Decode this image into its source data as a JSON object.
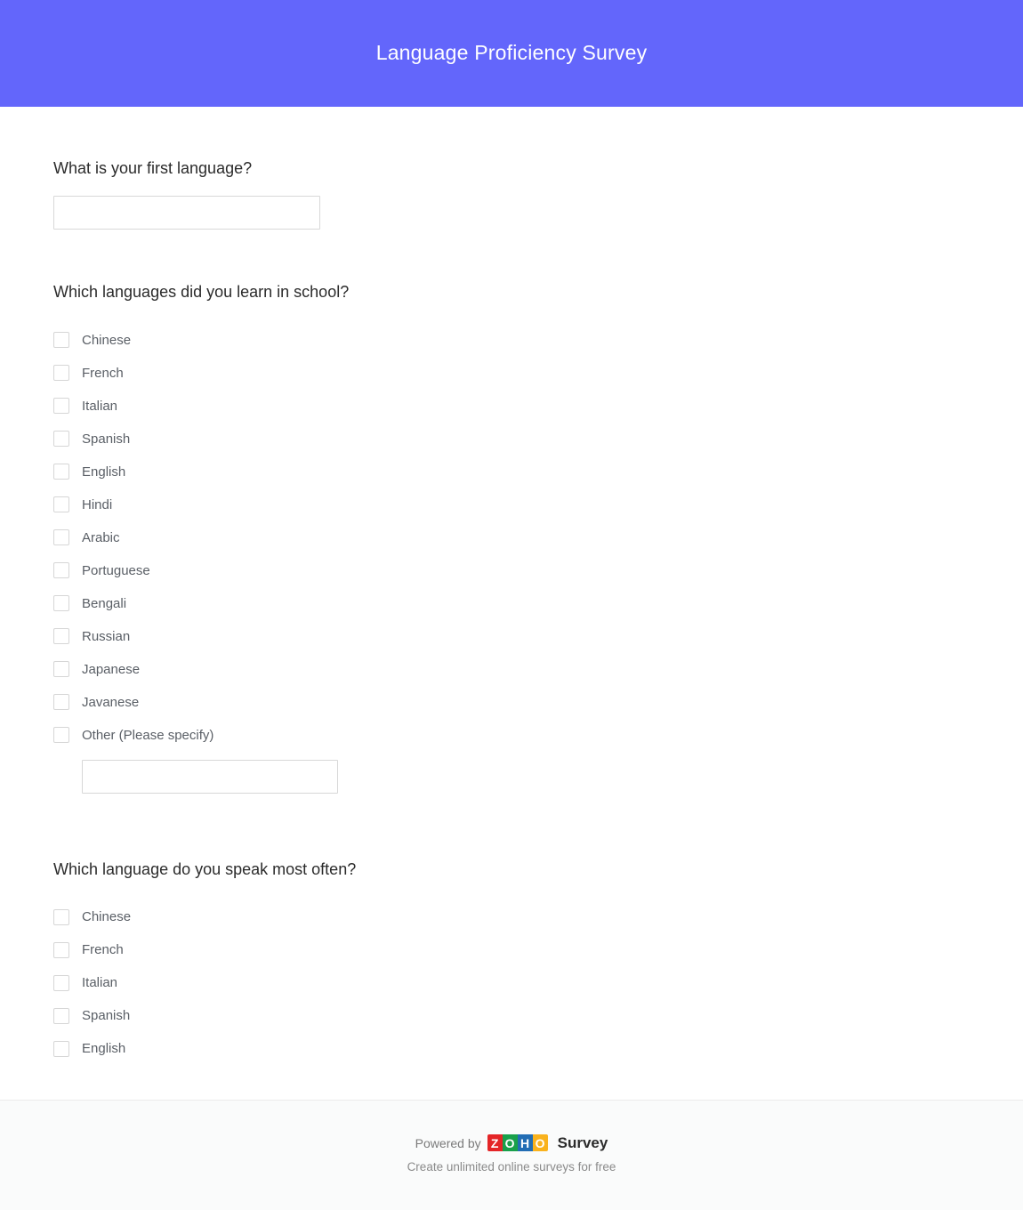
{
  "header": {
    "title": "Language Proficiency Survey",
    "background_color": "#6366fb",
    "text_color": "#ffffff"
  },
  "questions": [
    {
      "id": "q1",
      "title": "What is your first language?",
      "type": "short-text",
      "input": {
        "value": "",
        "placeholder": ""
      }
    },
    {
      "id": "q2",
      "title": "Which languages did you learn in school?",
      "type": "checkbox-multi",
      "options": [
        {
          "label": "Chinese",
          "checked": false
        },
        {
          "label": "French",
          "checked": false
        },
        {
          "label": "Italian",
          "checked": false
        },
        {
          "label": "Spanish",
          "checked": false
        },
        {
          "label": "English",
          "checked": false
        },
        {
          "label": "Hindi",
          "checked": false
        },
        {
          "label": "Arabic",
          "checked": false
        },
        {
          "label": "Portuguese",
          "checked": false
        },
        {
          "label": "Bengali",
          "checked": false
        },
        {
          "label": "Russian",
          "checked": false
        },
        {
          "label": "Japanese",
          "checked": false
        },
        {
          "label": "Javanese",
          "checked": false
        },
        {
          "label": "Other (Please specify)",
          "checked": false
        }
      ],
      "other_input": {
        "value": "",
        "placeholder": ""
      }
    },
    {
      "id": "q3",
      "title": "Which language do you speak most often?",
      "type": "checkbox-multi",
      "options": [
        {
          "label": "Chinese",
          "checked": false
        },
        {
          "label": "French",
          "checked": false
        },
        {
          "label": "Italian",
          "checked": false
        },
        {
          "label": "Spanish",
          "checked": false
        },
        {
          "label": "English",
          "checked": false
        }
      ]
    }
  ],
  "footer": {
    "powered_by": "Powered by",
    "brand_tiles": [
      {
        "letter": "Z",
        "color": "#e42527"
      },
      {
        "letter": "O",
        "color": "#19a04b"
      },
      {
        "letter": "H",
        "color": "#226db4"
      },
      {
        "letter": "O",
        "color": "#f9b21d"
      }
    ],
    "product": "Survey",
    "tagline": "Create unlimited online surveys for free"
  }
}
